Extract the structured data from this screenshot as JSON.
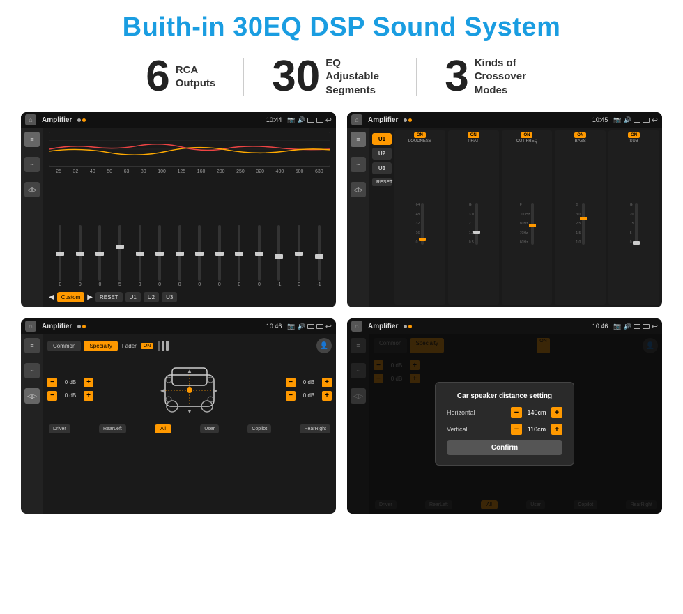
{
  "title": "Buith-in 30EQ DSP Sound System",
  "stats": [
    {
      "number": "6",
      "label": "RCA\nOutputs"
    },
    {
      "number": "30",
      "label": "EQ Adjustable\nSegments"
    },
    {
      "number": "3",
      "label": "Kinds of\nCrossover Modes"
    }
  ],
  "screen1": {
    "status_bar": {
      "app": "Amplifier",
      "time": "10:44",
      "indicators": "● ▶"
    },
    "eq_frequencies": [
      "25",
      "32",
      "40",
      "50",
      "63",
      "80",
      "100",
      "125",
      "160",
      "200",
      "250",
      "320",
      "400",
      "500",
      "630"
    ],
    "eq_values": [
      "0",
      "0",
      "0",
      "5",
      "0",
      "0",
      "0",
      "0",
      "0",
      "0",
      "0",
      "-1",
      "0",
      "-1"
    ],
    "buttons": [
      "◀",
      "Custom",
      "▶",
      "RESET",
      "U1",
      "U2",
      "U3"
    ]
  },
  "screen2": {
    "status_bar": {
      "app": "Amplifier",
      "time": "10:45"
    },
    "u_buttons": [
      "U1",
      "U2",
      "U3"
    ],
    "channels": [
      {
        "name": "LOUDNESS",
        "toggle": "ON"
      },
      {
        "name": "PHAT",
        "toggle": "ON"
      },
      {
        "name": "CUT FREQ",
        "toggle": "ON"
      },
      {
        "name": "BASS",
        "toggle": "ON"
      },
      {
        "name": "SUB",
        "toggle": "ON"
      }
    ],
    "reset": "RESET"
  },
  "screen3": {
    "status_bar": {
      "app": "Amplifier",
      "time": "10:46"
    },
    "tabs": [
      "Common",
      "Specialty"
    ],
    "fader_label": "Fader",
    "fader_toggle": "ON",
    "db_rows": [
      {
        "value": "0 dB"
      },
      {
        "value": "0 dB"
      },
      {
        "value": "0 dB"
      },
      {
        "value": "0 dB"
      }
    ],
    "buttons": [
      "Driver",
      "RearLeft",
      "All",
      "User",
      "Copilot",
      "RearRight"
    ]
  },
  "screen4": {
    "status_bar": {
      "app": "Amplifier",
      "time": "10:46"
    },
    "tabs": [
      "Common",
      "Specialty"
    ],
    "dialog": {
      "title": "Car speaker distance setting",
      "horizontal_label": "Horizontal",
      "horizontal_value": "140cm",
      "vertical_label": "Vertical",
      "vertical_value": "110cm",
      "confirm_label": "Confirm"
    },
    "db_rows": [
      {
        "value": "0 dB"
      },
      {
        "value": "0 dB"
      }
    ],
    "buttons": [
      "Driver",
      "RearLeft",
      "All",
      "User",
      "Copilot",
      "RearRight"
    ]
  }
}
